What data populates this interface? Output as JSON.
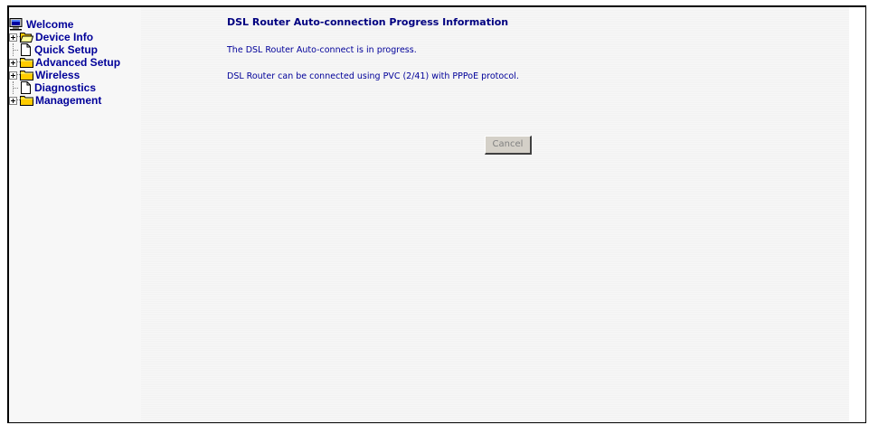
{
  "menu": {
    "items": [
      {
        "label": "Welcome",
        "icon": "computer-icon",
        "expandable": false
      },
      {
        "label": "Device Info",
        "icon": "folder-open-icon",
        "expandable": true
      },
      {
        "label": "Quick Setup",
        "icon": "page-icon",
        "expandable": false
      },
      {
        "label": "Advanced Setup",
        "icon": "folder-icon",
        "expandable": true
      },
      {
        "label": "Wireless",
        "icon": "folder-icon",
        "expandable": true
      },
      {
        "label": "Diagnostics",
        "icon": "page-icon",
        "expandable": false
      },
      {
        "label": "Management",
        "icon": "folder-icon",
        "expandable": true
      }
    ]
  },
  "main": {
    "title": "DSL Router Auto-connection Progress Information",
    "status_line_1": "The DSL Router Auto-connect is in progress.",
    "status_line_2": "DSL Router can be connected using PVC (2/41) with PPPoE protocol.",
    "cancel_label": "Cancel"
  },
  "colors": {
    "link": "#000099",
    "title": "#000080",
    "folder": "#ffcc00",
    "button_face": "#d4d0c8"
  }
}
